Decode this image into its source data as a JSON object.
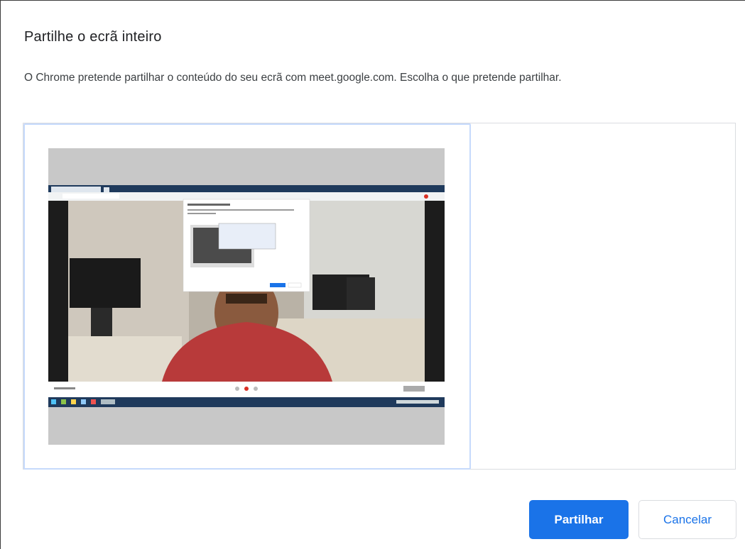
{
  "dialog": {
    "title": "Partilhe o ecrã inteiro",
    "description": "O Chrome pretende partilhar o conteúdo do seu ecrã com meet.google.com. Escolha o que pretende partilhar."
  },
  "picker": {
    "sources": [
      {
        "type": "entire-screen",
        "selected": true
      }
    ]
  },
  "buttons": {
    "share_label": "Partilhar",
    "cancel_label": "Cancelar"
  },
  "colors": {
    "accent": "#1a73e8",
    "selection_border": "#c6dafc",
    "thumbnail_letterbox": "#c8c8c8"
  }
}
